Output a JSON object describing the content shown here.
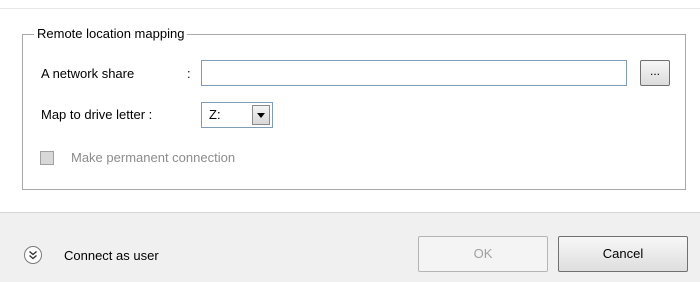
{
  "group": {
    "title": "Remote location mapping"
  },
  "network_share": {
    "label": "A network share",
    "colon": ":",
    "value": "",
    "browse_label": "..."
  },
  "drive": {
    "label": "Map to drive letter :",
    "selected": "Z:"
  },
  "permanent": {
    "label": "Make permanent connection",
    "checked": false,
    "enabled": false
  },
  "footer": {
    "connect_label": "Connect as user",
    "expand_icon": "chevron-double-down-icon",
    "ok_label": "OK",
    "cancel_label": "Cancel"
  }
}
